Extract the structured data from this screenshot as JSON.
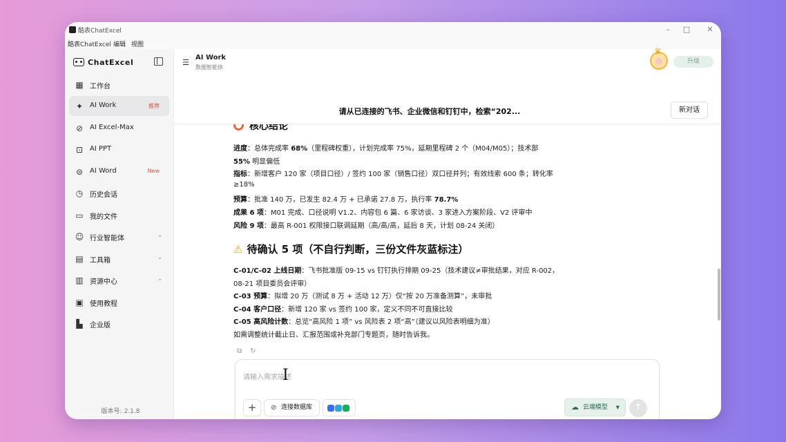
{
  "window": {
    "title": "酷表ChatExcel",
    "controls": [
      "minimize-icon",
      "maximize-icon",
      "close-icon"
    ]
  },
  "menubar": [
    "酷表ChatExcel",
    "编辑",
    "视图"
  ],
  "sidebar": {
    "brand": "ChatExcel",
    "items": [
      {
        "label": "工作台",
        "icon": "grid-icon"
      },
      {
        "label": "AI Work",
        "icon": "magic-wand-icon",
        "badge": "推荐",
        "active": true
      },
      {
        "label": "AI Excel-Max",
        "icon": "excel-icon"
      },
      {
        "label": "AI PPT",
        "icon": "ppt-icon"
      },
      {
        "label": "AI Word",
        "icon": "word-icon",
        "badge": "New"
      },
      {
        "label": "历史会话",
        "icon": "history-icon"
      },
      {
        "label": "我的文件",
        "icon": "folder-icon"
      },
      {
        "label": "行业智能体",
        "icon": "bot-icon",
        "chevron": true
      },
      {
        "label": "工具箱",
        "icon": "toolbox-icon",
        "chevron": true
      },
      {
        "label": "资源中心",
        "icon": "book-icon",
        "chevron": true
      },
      {
        "label": "使用教程",
        "icon": "tutorial-icon"
      },
      {
        "label": "企业版",
        "icon": "building-icon"
      }
    ],
    "version_label": "版本号:",
    "version": "2.1.8"
  },
  "header": {
    "agent_title": "AI Work",
    "agent_subtitle": "数据智能体",
    "upgrade": "升级",
    "chat_title": "请从已连接的飞书、企业微信和钉钉中，检索“202...",
    "new_chat": "新对话"
  },
  "content": {
    "heading1": "核心结论",
    "lines1": [
      {
        "b": "进度",
        "t": "：总体完成率 ",
        "b2": "68%",
        "t2": "（里程碑权重），计划完成率 75%，延期里程碑 2 个（M04/M05）；技术部"
      },
      {
        "b": "55%",
        "t": " 明显偏低"
      },
      {
        "b": "指标",
        "t": "：新增客户 120 家（项目口径）/ 签约 100 家（销售口径）双口径并列；有效线索 600 条；转化率"
      },
      {
        "b": "",
        "t": "≥18%"
      },
      {
        "b": "预算",
        "t": "：批准 140 万，已发生 82.4 万 + 已承诺 27.8 万，执行率 ",
        "b2": "78.7%",
        "t2": ""
      },
      {
        "b": "成果 6 项",
        "t": "：M01 完成、口径说明 V1.2、内容包 6 篇、6 家访谈、3 家进入方案阶段、V2 评审中"
      },
      {
        "b": "风险 9 项",
        "t": "：最高 R-001 权限接口联调延期（高/高/高，延后 8 天，计划 08-24 关闭）"
      }
    ],
    "heading2": "待确认 5 项（不自行判断，三份文件灰蓝标注）",
    "lines2": [
      {
        "b": "C-01/C-02 上线日期",
        "t": "：飞书批准版 09-15 vs 钉钉执行排期 09-25（技术建议≠审批结果，对应 R-002，"
      },
      {
        "b": "",
        "t": "08-21 项目委员会评审）"
      },
      {
        "b": "C-03 预算",
        "t": "：拟增 20 万（测试 8 万 + 活动 12 万）仅“按 20 万准备测算”，未审批"
      },
      {
        "b": "C-04 客户口径",
        "t": "：新增 120 家 vs 签约 100 家，定义不同不可直接比较"
      },
      {
        "b": "C-05 高风险计数",
        "t": "：总览“高风险 1 项” vs 风险表 2 项“高”（建议以风险表明细为准）"
      },
      {
        "b": "",
        "t": "如需调整统计截止日、汇报范围或补充部门专题页，随时告诉我。"
      }
    ]
  },
  "input": {
    "placeholder": "请输入需求描述",
    "db_label": "连接数据库",
    "model_label": "云端模型"
  }
}
